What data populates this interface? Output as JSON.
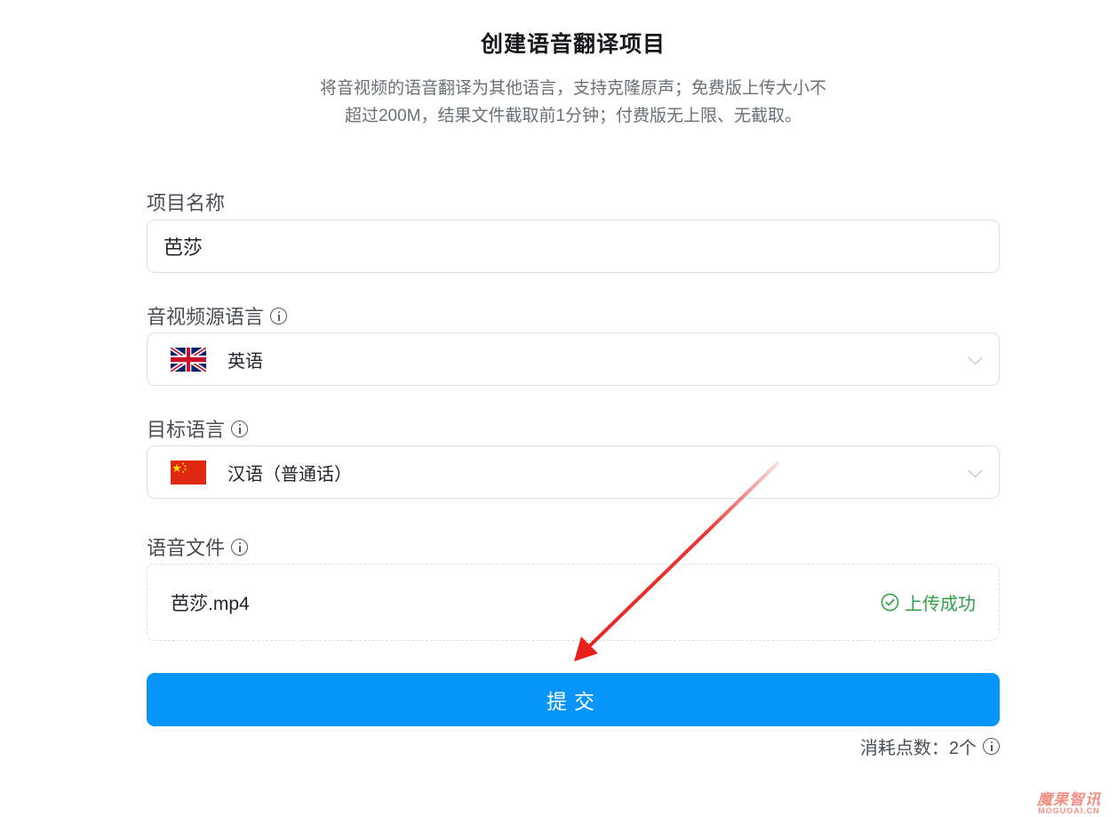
{
  "page": {
    "title": "创建语音翻译项目",
    "description_line1": "将音视频的语音翻译为其他语言，支持克隆原声；免费版上传大小不",
    "description_line2": "超过200M，结果文件截取前1分钟；付费版无上限、无截取。"
  },
  "form": {
    "project_name": {
      "label": "项目名称",
      "value": "芭莎",
      "placeholder": ""
    },
    "source_language": {
      "label": "音视频源语言",
      "selected": "英语",
      "flag_icon": "uk-flag-icon"
    },
    "target_language": {
      "label": "目标语言",
      "selected": "汉语（普通话）",
      "flag_icon": "china-flag-icon"
    },
    "audio_file": {
      "label": "语音文件",
      "file_name": "芭莎.mp4",
      "status": "上传成功"
    }
  },
  "submit": {
    "label": "提交"
  },
  "cost": {
    "text": "消耗点数：2个"
  },
  "watermark": {
    "cn": "魔果智讯",
    "en": "MOGUOAI.CN"
  },
  "colors": {
    "primary": "#0895fb",
    "success": "#2fa14a",
    "annotation_arrow": "#e8211c",
    "border": "#dcdfe4"
  }
}
